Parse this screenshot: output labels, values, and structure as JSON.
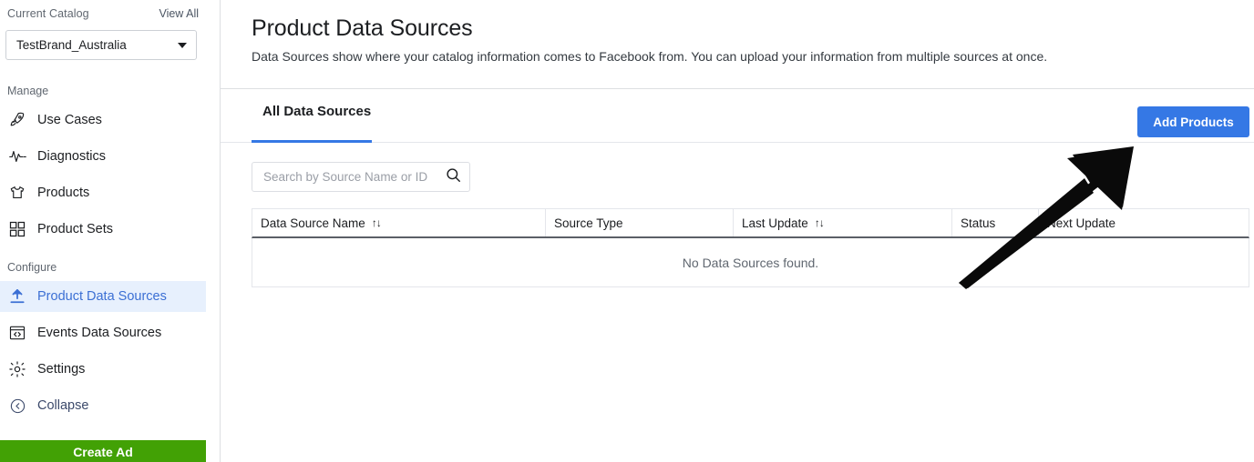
{
  "sidebar": {
    "catalog": {
      "label": "Current Catalog",
      "view_all": "View All",
      "selected": "TestBrand_Australia",
      "caret_icon": "chevron-down-icon"
    },
    "groups": [
      {
        "label": "Manage"
      },
      {
        "label": "Configure"
      }
    ],
    "manage_items": [
      {
        "label": "Use Cases",
        "icon": "rocket-icon",
        "active": false
      },
      {
        "label": "Diagnostics",
        "icon": "pulse-icon",
        "active": false
      },
      {
        "label": "Products",
        "icon": "tshirt-icon",
        "active": false
      },
      {
        "label": "Product Sets",
        "icon": "grid-icon",
        "active": false
      }
    ],
    "configure_items": [
      {
        "label": "Product Data Sources",
        "icon": "upload-icon",
        "active": true
      },
      {
        "label": "Events Data Sources",
        "icon": "code-window-icon",
        "active": false
      },
      {
        "label": "Settings",
        "icon": "gear-icon",
        "active": false
      },
      {
        "label": "Collapse",
        "icon": "chevron-left-circle-icon",
        "active": false
      }
    ],
    "create_ad_label": "Create Ad",
    "create_ad_color": "#42a105",
    "active_item_bg": "#e7f0fd",
    "active_item_color": "#3b6fd4"
  },
  "header": {
    "title": "Product Data Sources",
    "subtitle": "Data Sources show where your catalog information comes to Facebook from. You can upload your information from multiple sources at once."
  },
  "tabs": [
    {
      "label": "All Data Sources",
      "selected": true
    }
  ],
  "toolbar": {
    "add_products_label": "Add Products",
    "add_products_color": "#3578e5"
  },
  "search": {
    "placeholder": "Search by Source Name or ID",
    "value": "",
    "icon": "search-icon"
  },
  "table": {
    "columns": [
      {
        "label": "Data Source Name",
        "sortable": true,
        "sort_icon": "↑↓"
      },
      {
        "label": "Source Type",
        "sortable": false,
        "sort_icon": ""
      },
      {
        "label": "Last Update",
        "sortable": true,
        "sort_icon": "↑↓"
      },
      {
        "label": "Status",
        "sortable": false,
        "sort_icon": ""
      },
      {
        "label": "Next Update",
        "sortable": false,
        "sort_icon": ""
      }
    ],
    "rows": [],
    "empty_message": "No Data Sources found."
  },
  "annotation": {
    "type": "arrow",
    "color": "#0a0a0a",
    "points_to": "add-products-button"
  }
}
